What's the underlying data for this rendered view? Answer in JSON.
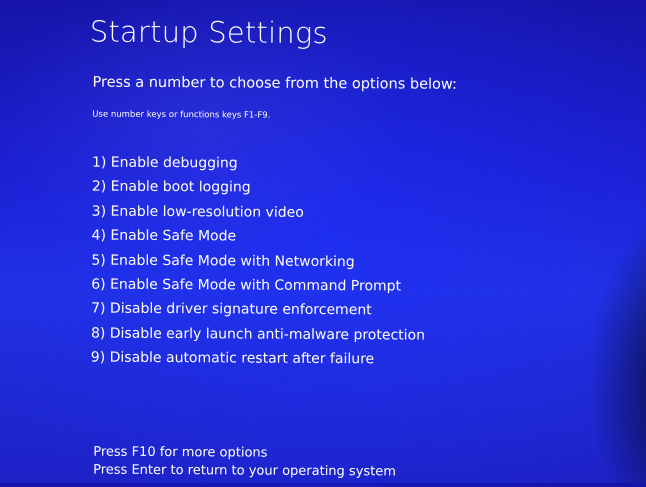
{
  "screen": {
    "title": "Startup Settings",
    "subtitle": "Press a number to choose from the options below:",
    "hint": "Use number keys or functions keys F1-F9."
  },
  "options": [
    "1) Enable debugging",
    "2) Enable boot logging",
    "3) Enable low-resolution video",
    "4) Enable Safe Mode",
    "5) Enable Safe Mode with Networking",
    "6) Enable Safe Mode with Command Prompt",
    "7) Disable driver signature enforcement",
    "8) Disable early launch anti-malware protection",
    "9) Disable automatic restart after failure"
  ],
  "footer": {
    "more_options": "Press F10 for more options",
    "return": "Press Enter to return to your operating system"
  },
  "colors": {
    "background": "#1c1fd0",
    "text": "#ffffff"
  }
}
